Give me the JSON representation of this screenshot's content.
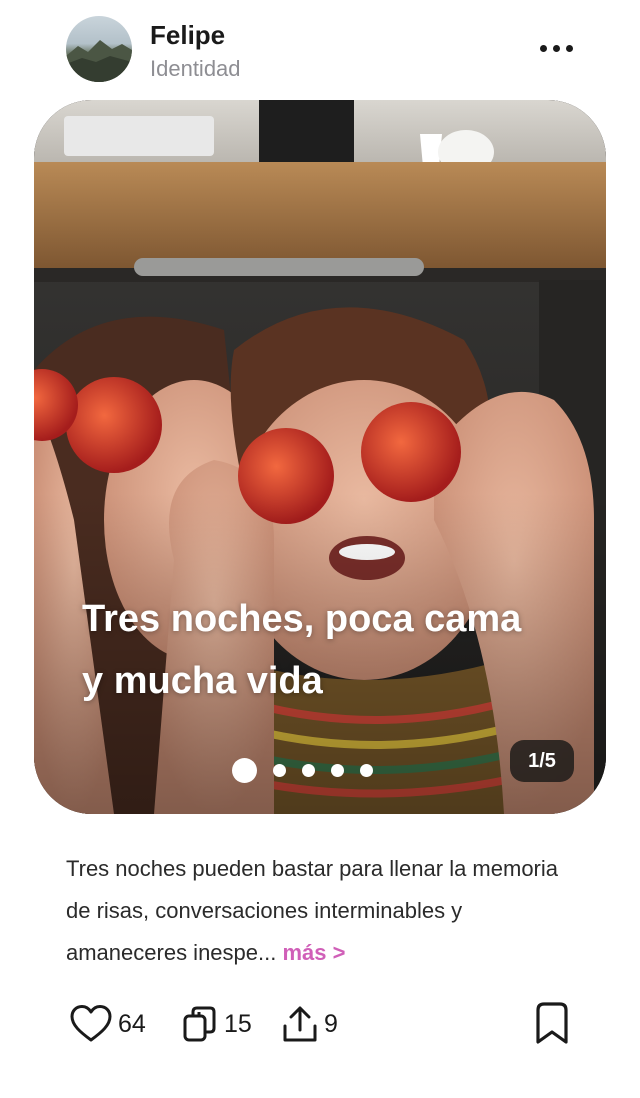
{
  "header": {
    "username": "Felipe",
    "subtitle": "Identidad",
    "avatar_icon": "avatar-landscape",
    "menu_icon": "more-horizontal-icon"
  },
  "carousel": {
    "title": "Tres noches, poca cama y mucha vida",
    "counter": "1/5",
    "current_slide": 1,
    "total_slides": 5
  },
  "caption": {
    "text": "Tres noches pueden bastar para llenar la memoria de risas, conversaciones interminables y amaneceres inespe...",
    "more": "más >"
  },
  "actions": {
    "likes": "64",
    "reposts": "15",
    "shares": "9",
    "icons": [
      "heart-icon",
      "repost-icon",
      "share-icon",
      "bookmark-icon"
    ]
  },
  "colors": {
    "accent": "#d05fb8",
    "text": "#1c1c1e",
    "muted": "#8e8e93"
  }
}
